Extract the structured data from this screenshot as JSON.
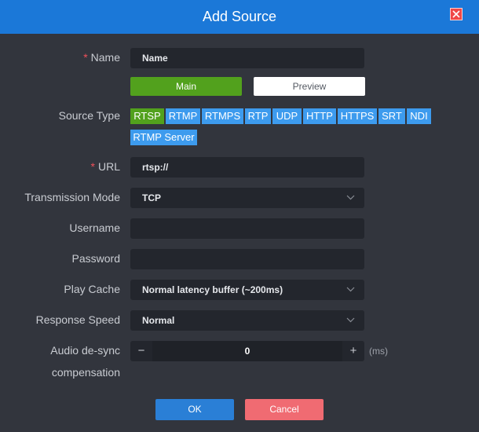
{
  "dialog": {
    "title": "Add Source"
  },
  "colors": {
    "header": "#1b78d8",
    "background": "#32353d",
    "field": "#23262d",
    "active_green": "#52a11d",
    "chip_blue": "#3d9bee",
    "ok_blue": "#2a7fd6",
    "cancel_red": "#f06b72",
    "required": "#f0505a"
  },
  "icons": {
    "close": "close-icon",
    "dropdown": "chevron-down-icon"
  },
  "fields": {
    "name": {
      "label": "Name",
      "required": "*",
      "value": "Name"
    },
    "stream_tabs": {
      "main": "Main",
      "preview": "Preview",
      "active": "Main"
    },
    "source_type": {
      "label": "Source Type",
      "options": [
        "RTSP",
        "RTMP",
        "RTMPS",
        "RTP",
        "UDP",
        "HTTP",
        "HTTPS",
        "SRT",
        "NDI",
        "RTMP Server"
      ],
      "selected": "RTSP"
    },
    "url": {
      "label": "URL",
      "required": "*",
      "value": "rtsp://"
    },
    "transmission_mode": {
      "label": "Transmission Mode",
      "value": "TCP"
    },
    "username": {
      "label": "Username",
      "value": ""
    },
    "password": {
      "label": "Password",
      "value": ""
    },
    "play_cache": {
      "label": "Play Cache",
      "value": "Normal latency buffer (~200ms)"
    },
    "response_speed": {
      "label": "Response Speed",
      "value": "Normal"
    },
    "audio_desync": {
      "label_line1": "Audio de-sync",
      "label_line2": "compensation",
      "value": "0",
      "minus": "−",
      "plus": "+",
      "unit": "(ms)"
    }
  },
  "buttons": {
    "ok": "OK",
    "cancel": "Cancel"
  }
}
